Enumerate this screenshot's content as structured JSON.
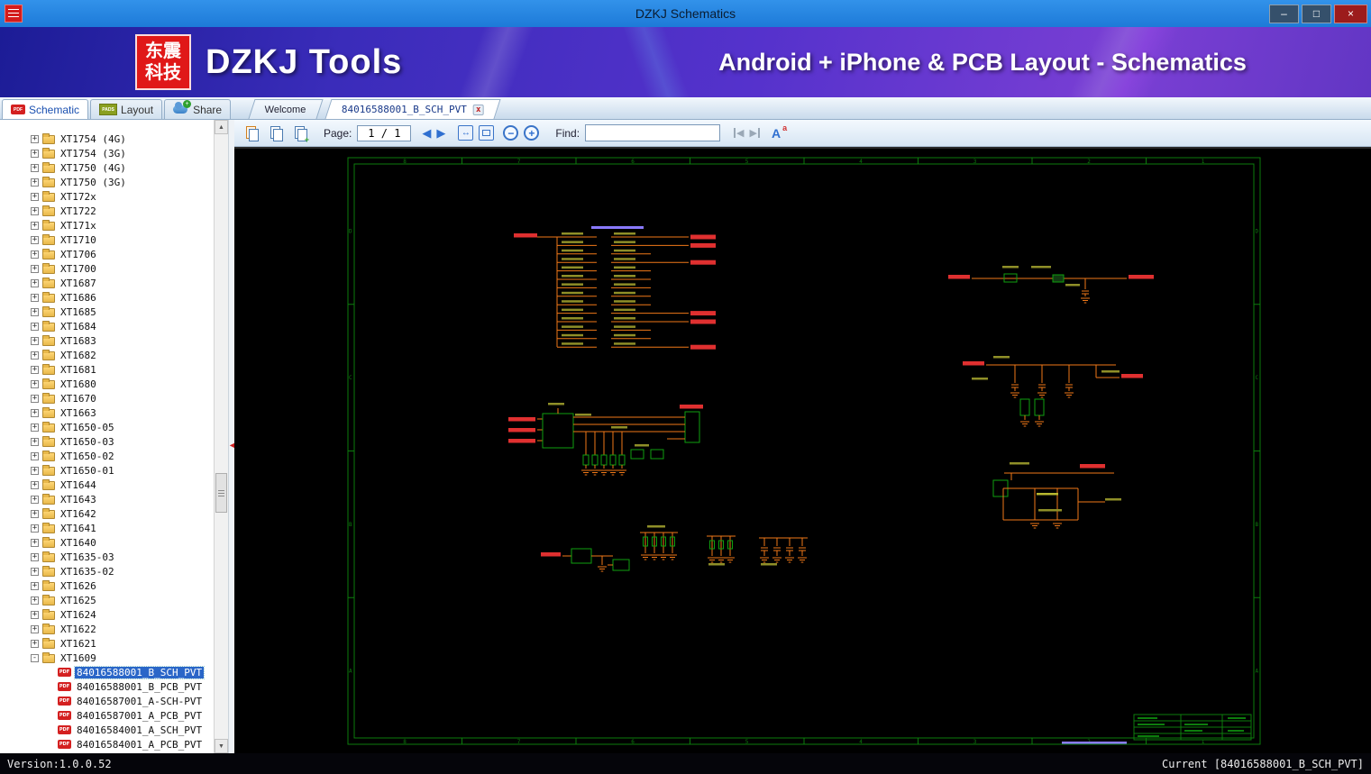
{
  "window": {
    "title": "DZKJ Schematics",
    "minimize_label": "–",
    "maximize_label": "□",
    "close_label": "×"
  },
  "banner": {
    "logo_line1": "东震",
    "logo_line2": "科技",
    "brand": "DZKJ Tools",
    "tagline": "Android + iPhone & PCB Layout - Schematics"
  },
  "tabs": {
    "app": [
      {
        "label": "Schematic",
        "active": true
      },
      {
        "label": "Layout",
        "active": false
      },
      {
        "label": "Share",
        "active": false
      }
    ],
    "documents": [
      {
        "label": "Welcome",
        "active": false,
        "closable": false
      },
      {
        "label": "84016588001_B_SCH_PVT",
        "active": true,
        "closable": true
      }
    ]
  },
  "toolbar": {
    "page_label": "Page:",
    "page_display": "1 / 1",
    "find_label": "Find:",
    "find_value": ""
  },
  "sidebar": {
    "items": [
      {
        "label": "XT1754 (4G)",
        "type": "folder",
        "level": 0,
        "expanded": false
      },
      {
        "label": "XT1754 (3G)",
        "type": "folder",
        "level": 0,
        "expanded": false
      },
      {
        "label": "XT1750 (4G)",
        "type": "folder",
        "level": 0,
        "expanded": false
      },
      {
        "label": "XT1750 (3G)",
        "type": "folder",
        "level": 0,
        "expanded": false
      },
      {
        "label": "XT172x",
        "type": "folder",
        "level": 0,
        "expanded": false
      },
      {
        "label": "XT1722",
        "type": "folder",
        "level": 0,
        "expanded": false
      },
      {
        "label": "XT171x",
        "type": "folder",
        "level": 0,
        "expanded": false
      },
      {
        "label": "XT1710",
        "type": "folder",
        "level": 0,
        "expanded": false
      },
      {
        "label": "XT1706",
        "type": "folder",
        "level": 0,
        "expanded": false
      },
      {
        "label": "XT1700",
        "type": "folder",
        "level": 0,
        "expanded": false
      },
      {
        "label": "XT1687",
        "type": "folder",
        "level": 0,
        "expanded": false
      },
      {
        "label": "XT1686",
        "type": "folder",
        "level": 0,
        "expanded": false
      },
      {
        "label": "XT1685",
        "type": "folder",
        "level": 0,
        "expanded": false
      },
      {
        "label": "XT1684",
        "type": "folder",
        "level": 0,
        "expanded": false
      },
      {
        "label": "XT1683",
        "type": "folder",
        "level": 0,
        "expanded": false
      },
      {
        "label": "XT1682",
        "type": "folder",
        "level": 0,
        "expanded": false
      },
      {
        "label": "XT1681",
        "type": "folder",
        "level": 0,
        "expanded": false
      },
      {
        "label": "XT1680",
        "type": "folder",
        "level": 0,
        "expanded": false
      },
      {
        "label": "XT1670",
        "type": "folder",
        "level": 0,
        "expanded": false
      },
      {
        "label": "XT1663",
        "type": "folder",
        "level": 0,
        "expanded": false
      },
      {
        "label": "XT1650-05",
        "type": "folder",
        "level": 0,
        "expanded": false
      },
      {
        "label": "XT1650-03",
        "type": "folder",
        "level": 0,
        "expanded": false
      },
      {
        "label": "XT1650-02",
        "type": "folder",
        "level": 0,
        "expanded": false
      },
      {
        "label": "XT1650-01",
        "type": "folder",
        "level": 0,
        "expanded": false
      },
      {
        "label": "XT1644",
        "type": "folder",
        "level": 0,
        "expanded": false
      },
      {
        "label": "XT1643",
        "type": "folder",
        "level": 0,
        "expanded": false
      },
      {
        "label": "XT1642",
        "type": "folder",
        "level": 0,
        "expanded": false
      },
      {
        "label": "XT1641",
        "type": "folder",
        "level": 0,
        "expanded": false
      },
      {
        "label": "XT1640",
        "type": "folder",
        "level": 0,
        "expanded": false
      },
      {
        "label": "XT1635-03",
        "type": "folder",
        "level": 0,
        "expanded": false
      },
      {
        "label": "XT1635-02",
        "type": "folder",
        "level": 0,
        "expanded": false
      },
      {
        "label": "XT1626",
        "type": "folder",
        "level": 0,
        "expanded": false
      },
      {
        "label": "XT1625",
        "type": "folder",
        "level": 0,
        "expanded": false
      },
      {
        "label": "XT1624",
        "type": "folder",
        "level": 0,
        "expanded": false
      },
      {
        "label": "XT1622",
        "type": "folder",
        "level": 0,
        "expanded": false
      },
      {
        "label": "XT1621",
        "type": "folder",
        "level": 0,
        "expanded": false
      },
      {
        "label": "XT1609",
        "type": "folder",
        "level": 0,
        "expanded": true
      },
      {
        "label": "84016588001_B_SCH_PVT",
        "type": "pdf",
        "level": 1,
        "selected": true
      },
      {
        "label": "84016588001_B_PCB_PVT",
        "type": "pdf",
        "level": 1,
        "selected": false
      },
      {
        "label": "84016587001_A-SCH-PVT",
        "type": "pdf",
        "level": 1,
        "selected": false
      },
      {
        "label": "84016587001_A_PCB_PVT",
        "type": "pdf",
        "level": 1,
        "selected": false
      },
      {
        "label": "84016584001_A_SCH_PVT",
        "type": "pdf",
        "level": 1,
        "selected": false
      },
      {
        "label": "84016584001_A_PCB_PVT",
        "type": "pdf",
        "level": 1,
        "selected": false
      }
    ]
  },
  "icons": {
    "pdf_label": "PDF",
    "pads_label": "PADS",
    "prev_page": "◀",
    "next_page": "▶",
    "fit_width": "↔",
    "zoom_out": "−",
    "zoom_in": "+",
    "find_prev": "◀",
    "find_next": "▶",
    "font_a": "A",
    "font_a_small": "a",
    "scroll_up": "▲",
    "scroll_down": "▼",
    "collapse": "◄",
    "expander_open": "-",
    "expander_closed": "+",
    "close_tab": "x"
  },
  "statusbar": {
    "version": "Version:1.0.0.52",
    "current": "Current [84016588001_B_SCH_PVT]"
  }
}
